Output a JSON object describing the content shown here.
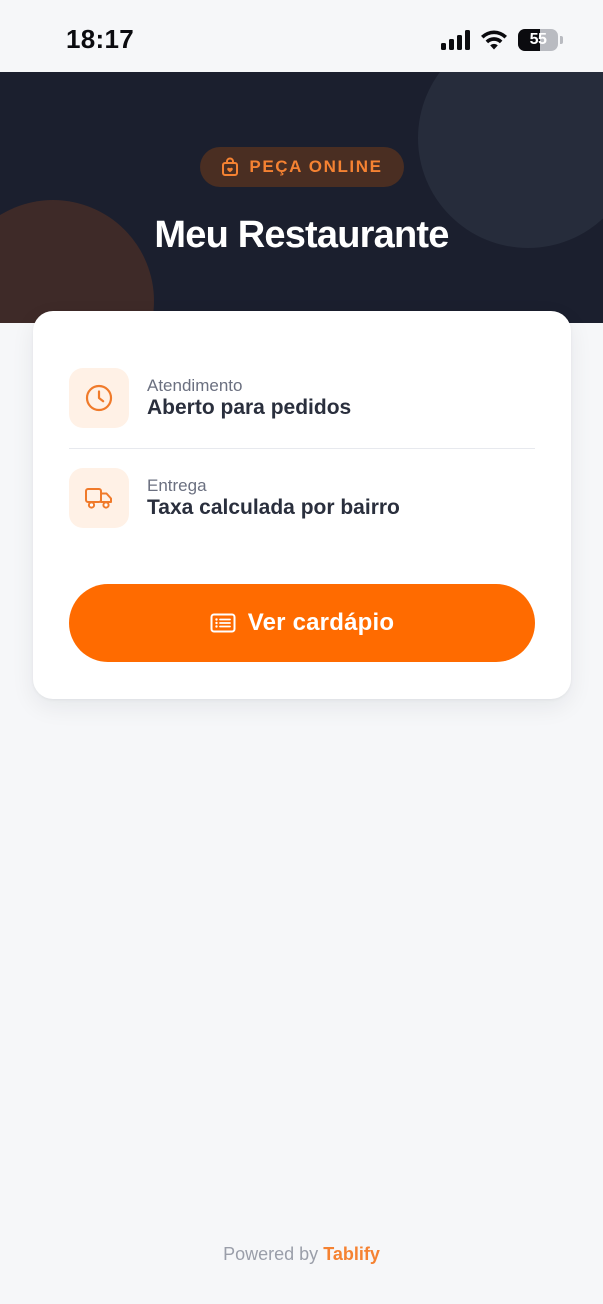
{
  "status_bar": {
    "time": "18:17",
    "battery_percent": "55",
    "battery_level": 0.55,
    "icons": [
      "signal-icon",
      "wifi-icon",
      "battery-icon"
    ]
  },
  "hero": {
    "badge_icon": "shopping-bag-icon",
    "badge_label": "PEÇA ONLINE",
    "title": "Meu Restaurante"
  },
  "card": {
    "rows": [
      {
        "icon": "clock-icon",
        "label": "Atendimento",
        "value": "Aberto para pedidos"
      },
      {
        "icon": "truck-icon",
        "label": "Entrega",
        "value": "Taxa calculada por bairro"
      }
    ],
    "cta": {
      "icon": "menu-list-icon",
      "label": "Ver cardápio"
    }
  },
  "footer": {
    "prefix": "Powered by ",
    "brand": "Tablify"
  },
  "colors": {
    "accent": "#ff6b00",
    "accent_text": "#f58232",
    "hero_bg": "#1b1f2e",
    "page_bg": "#f6f7f9",
    "icon_bg": "#fff1e6"
  }
}
